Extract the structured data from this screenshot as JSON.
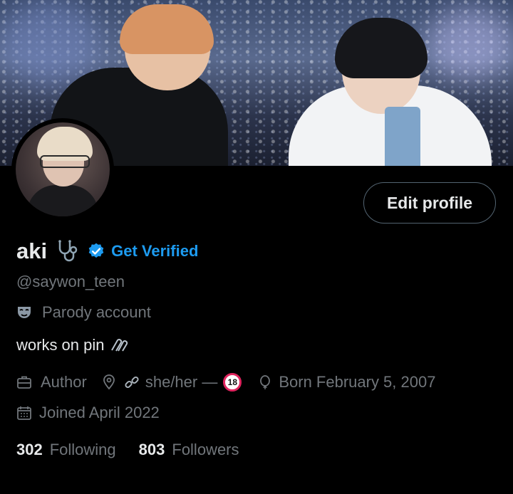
{
  "profile": {
    "name": "aki",
    "get_verified": "Get Verified",
    "handle": "@saywon_teen",
    "parody_label": "Parody account",
    "bio": "works on pin",
    "edit_profile": "Edit profile",
    "meta": {
      "occupation": "Author",
      "pronouns": "she/her —",
      "born": "Born February 5, 2007",
      "joined": "Joined April 2022"
    },
    "following_count": "302",
    "following_label": "Following",
    "followers_count": "803",
    "followers_label": "Followers"
  },
  "icons": {
    "name_emoji": "stethoscope-icon",
    "verified": "verified-badge-icon",
    "parody": "mask-icon",
    "bio_emoji": "paperclip-icon",
    "occupation": "briefcase-icon",
    "location": "location-pin-icon",
    "link": "link-icon",
    "age_rating": "no-under-18-icon",
    "born": "balloon-icon",
    "joined": "calendar-icon"
  },
  "colors": {
    "background": "#000000",
    "primary_text": "#e7e9ea",
    "secondary_text": "#71767b",
    "accent": "#1d9bf0",
    "button_border": "#536471"
  }
}
